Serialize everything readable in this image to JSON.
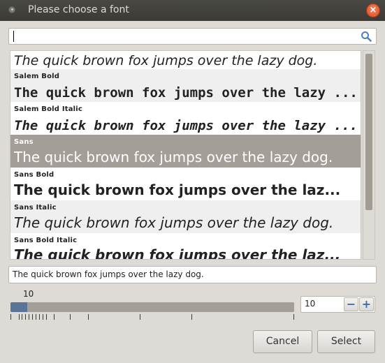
{
  "window": {
    "title": "Please choose a font",
    "close_glyph": "×"
  },
  "search": {
    "value": "",
    "icon": "search-icon"
  },
  "font_list": {
    "rows": [
      {
        "name": "",
        "sample": "The quick brown fox jumps over the lazy dog."
      },
      {
        "name": "Salem Bold",
        "sample": "The quick brown fox jumps over the lazy ..."
      },
      {
        "name": "Salem Bold Italic",
        "sample": "The quick brown fox jumps over the lazy ..."
      },
      {
        "name": "Sans",
        "sample": "The quick brown fox jumps over the lazy dog."
      },
      {
        "name": "Sans Bold",
        "sample": "The quick brown fox jumps over the laz..."
      },
      {
        "name": "Sans Italic",
        "sample": "The quick brown fox jumps over the lazy dog."
      },
      {
        "name": "Sans Bold Italic",
        "sample": "The quick brown fox jumps over the laz..."
      }
    ],
    "selected": "Sans"
  },
  "preview": {
    "text": "The quick brown fox jumps over the lazy dog."
  },
  "size": {
    "label": "10",
    "value": "10",
    "slider_fraction": 0.06,
    "minus_glyph": "−",
    "plus_glyph": "+"
  },
  "buttons": {
    "cancel": "Cancel",
    "select": "Select"
  },
  "colors": {
    "selection": "#a39e97",
    "slider_fill": "#5a7398",
    "titlebar": "#3b3a36",
    "close": "#dc4a1d"
  }
}
